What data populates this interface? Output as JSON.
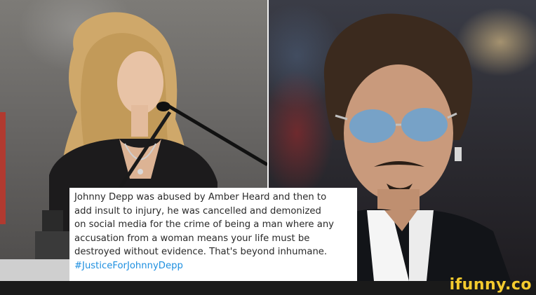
{
  "tweet": {
    "lines": [
      "Johnny Depp was abused by Amber Heard and then to",
      "add insult to injury, he was cancelled and demonized",
      "on social media for the crime of being a man where any",
      "accusation from a woman means your life must be",
      "destroyed without evidence. That's beyond inhumane."
    ],
    "hashtag": "#JusticeForJohnnyDepp"
  },
  "watermark": {
    "text": "ifunny.co",
    "color": "#f4cb2e"
  },
  "colors": {
    "hashtag": "#1d8fe0",
    "tweet_background": "#ffffff",
    "tweet_text": "#2a2a2a"
  }
}
